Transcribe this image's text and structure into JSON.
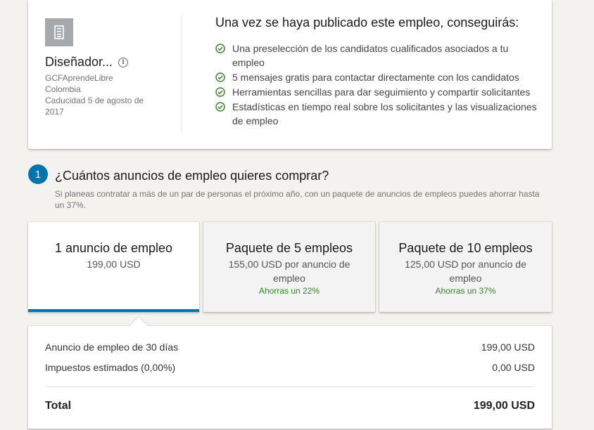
{
  "job": {
    "title": "Diseñador...",
    "company": "GCFAprendeLibre",
    "location": "Colombia",
    "expiry": "Caducidad 5 de agosto de 2017"
  },
  "benefits": {
    "title": "Una vez se haya publicado este empleo, conseguirás:",
    "items": [
      "Una preselección de los candidatos cualificados asociados a tu empleo",
      "5 mensajes gratis para contactar directamente con los candidatos",
      "Herramientas sencillas para dar seguimiento y compartir solicitantes",
      "Estadísticas en tiempo real sobre los solicitantes y las visualizaciones de empleo"
    ]
  },
  "step": {
    "number": "1",
    "title": "¿Cuántos anuncios de empleo quieres comprar?",
    "subtitle": "Si planeas contratar a más de un par de personas el próximo año, con un paquete de anuncios de empleos puedes ahorrar hasta un 37%."
  },
  "packages": [
    {
      "title": "1 anuncio de empleo",
      "price": "199,00 USD",
      "savings": "",
      "selected": true
    },
    {
      "title": "Paquete de 5 empleos",
      "price": "155,00 USD por anuncio de empleo",
      "savings": "Ahorras un 22%",
      "selected": false
    },
    {
      "title": "Paquete de 10 empleos",
      "price": "125,00 USD por anuncio de empleo",
      "savings": "Ahorras un 37%",
      "selected": false
    }
  ],
  "summary": {
    "line1_label": "Anuncio de empleo de 30 días",
    "line1_value": "199,00 USD",
    "line2_label": "Impuestos estimados (0,00%)",
    "line2_value": "0,00 USD",
    "total_label": "Total",
    "total_value": "199,00 USD"
  },
  "colors": {
    "accent": "#0073b1",
    "success": "#2e8a1f",
    "check": "#3a8a2a"
  },
  "icons": {
    "company_logo": "building-icon",
    "info": "info-icon",
    "benefit": "check-circle-icon"
  }
}
